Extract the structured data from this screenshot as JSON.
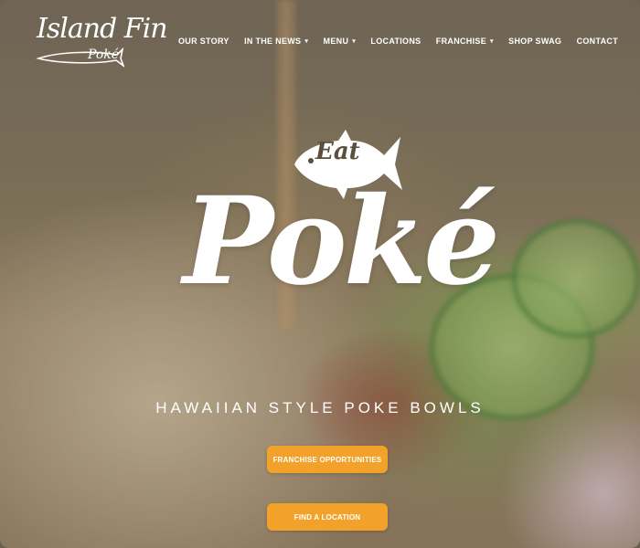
{
  "logo": {
    "name": "Island Fin",
    "sub": "Poké"
  },
  "nav": {
    "items": [
      {
        "label": "OUR STORY",
        "dropdown": false
      },
      {
        "label": "IN THE NEWS",
        "dropdown": true
      },
      {
        "label": "MENU",
        "dropdown": true
      },
      {
        "label": "LOCATIONS",
        "dropdown": false
      },
      {
        "label": "FRANCHISE",
        "dropdown": true
      },
      {
        "label": "SHOP SWAG",
        "dropdown": false
      },
      {
        "label": "CONTACT",
        "dropdown": false
      }
    ]
  },
  "hero": {
    "eat": "Eat",
    "title": "Poké",
    "tagline": "HAWAIIAN STYLE POKE BOWLS",
    "buttons": [
      {
        "label": "FRANCHISE OPPORTUNITIES"
      },
      {
        "label": "FIND A LOCATION"
      }
    ]
  },
  "colors": {
    "accent": "#f2a22a",
    "text": "#ffffff"
  }
}
